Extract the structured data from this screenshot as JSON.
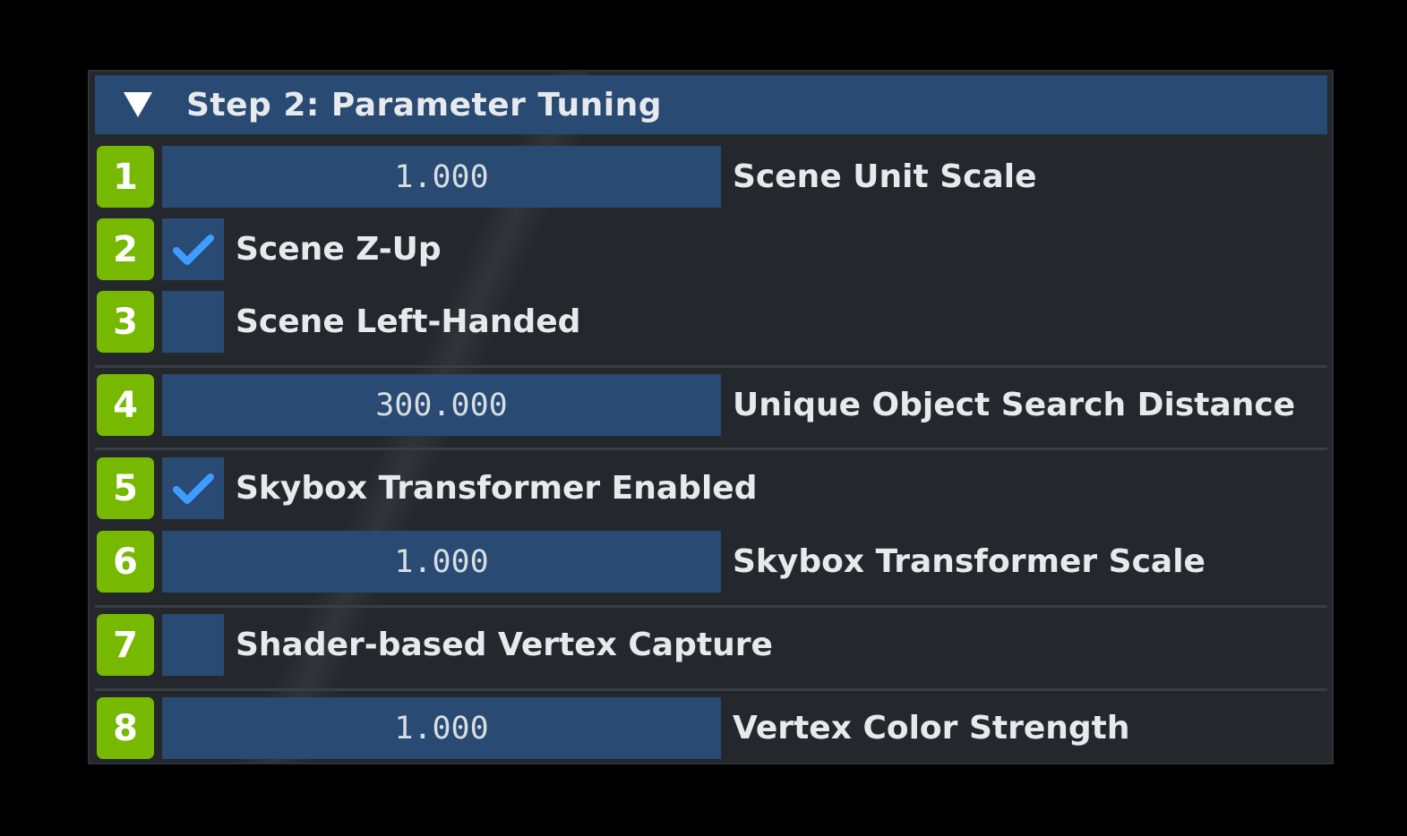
{
  "section": {
    "title": "Step 2: Parameter Tuning",
    "collapse_icon": "triangle-down-icon"
  },
  "rows": [
    {
      "badge": "1",
      "kind": "number",
      "value": "1.000",
      "label": "Scene Unit Scale"
    },
    {
      "badge": "2",
      "kind": "checkbox",
      "checked": true,
      "label": "Scene Z-Up"
    },
    {
      "badge": "3",
      "kind": "checkbox",
      "checked": false,
      "label": "Scene Left-Handed"
    },
    {
      "badge": "4",
      "kind": "number",
      "value": "300.000",
      "label": "Unique Object Search Distance"
    },
    {
      "badge": "5",
      "kind": "checkbox",
      "checked": true,
      "label": "Skybox Transformer Enabled"
    },
    {
      "badge": "6",
      "kind": "number",
      "value": "1.000",
      "label": "Skybox Transformer Scale"
    },
    {
      "badge": "7",
      "kind": "checkbox",
      "checked": false,
      "label": "Shader-based Vertex Capture"
    },
    {
      "badge": "8",
      "kind": "number",
      "value": "1.000",
      "label": "Vertex Color Strength"
    }
  ],
  "colors": {
    "badge": "#76b900",
    "field": "#284a73",
    "panel": "#24282c",
    "check": "#3f9cff",
    "text": "#e7eaed"
  }
}
